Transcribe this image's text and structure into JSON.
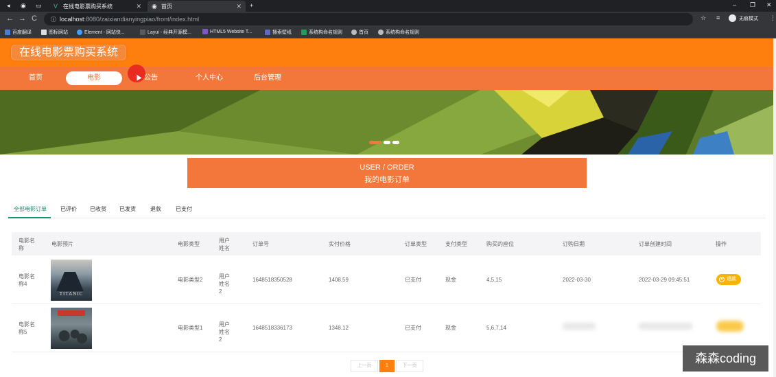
{
  "browser": {
    "tabs": [
      {
        "title": "在线电影票购买系统",
        "active": false
      },
      {
        "title": "首页",
        "active": true
      }
    ],
    "url_host": "localhost",
    "url_path": ":8080/zaixiandianyingpiao/front/index.html",
    "profile_label": "无痕模式",
    "bookmarks": [
      "百度翻译",
      "图标网站",
      "Element - 网站快...",
      "Layui - 经典开源模...",
      "HTML5 Website T...",
      "搜索壁纸",
      "系统构命名规则",
      "首页",
      "系统构命名规则"
    ]
  },
  "site": {
    "title": "在线电影票购买系统",
    "nav": [
      "首页",
      "电影",
      "公告",
      "个人中心",
      "后台管理"
    ],
    "active_nav": "电影"
  },
  "order_header": {
    "en": "USER / ORDER",
    "cn": "我的电影订单"
  },
  "order_tabs": [
    "全部电影订单",
    "已评价",
    "已收货",
    "已发货",
    "退款",
    "已支付"
  ],
  "table": {
    "headers": [
      "电影名称",
      "电影预片",
      "电影类型",
      "用户姓名",
      "订单号",
      "实付价格",
      "订单类型",
      "支付类型",
      "购买的座位",
      "订购日期",
      "订单创建时间",
      "操作"
    ],
    "rows": [
      {
        "name": "电影名称4",
        "type": "电影类型2",
        "user": "用户姓名2",
        "order_no": "1648518350528",
        "price": "1408.59",
        "order_type": "已支付",
        "pay_type": "现金",
        "seats": "4,5,15",
        "date": "2022-03-30",
        "created": "2022-03-29 09:45:51",
        "action": "退款",
        "poster": "TITANIC"
      },
      {
        "name": "电影名称5",
        "type": "电影类型1",
        "user": "用户姓名2",
        "order_no": "1648518336173",
        "price": "1348.12",
        "order_type": "已支付",
        "pay_type": "现金",
        "seats": "5,6,7,14",
        "date": "",
        "created": "",
        "action": "",
        "poster": ""
      }
    ]
  },
  "pagination": {
    "prev": "上一页",
    "current": "1",
    "next": "下一页"
  },
  "watermark": "森森coding",
  "colors": {
    "brand": "#ff7f0e",
    "nav": "#f3773a",
    "tab_active": "#0b9a72",
    "btn": "#f8b400"
  }
}
